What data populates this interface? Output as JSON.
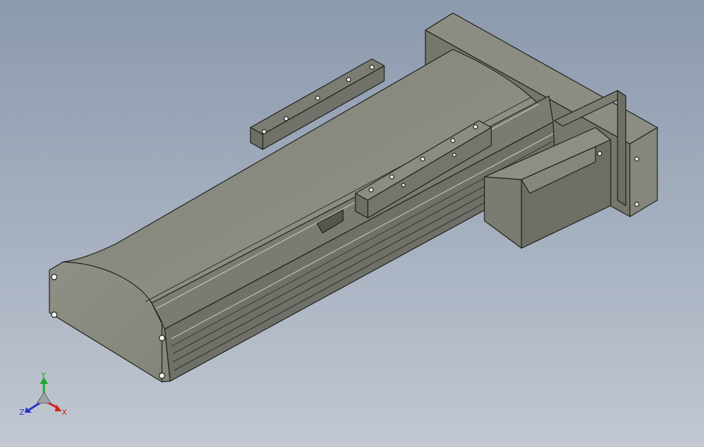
{
  "viewport": {
    "background_top": "#8c9aae",
    "background_bottom": "#c2c8d2",
    "model_face_color": "#8a8b7e",
    "model_edge_color": "#1e1e1a"
  },
  "triad": {
    "x_label": "X",
    "y_label": "Y",
    "z_label": "Z",
    "x_color": "#d42020",
    "y_color": "#22a82a",
    "z_color": "#2430c8"
  }
}
